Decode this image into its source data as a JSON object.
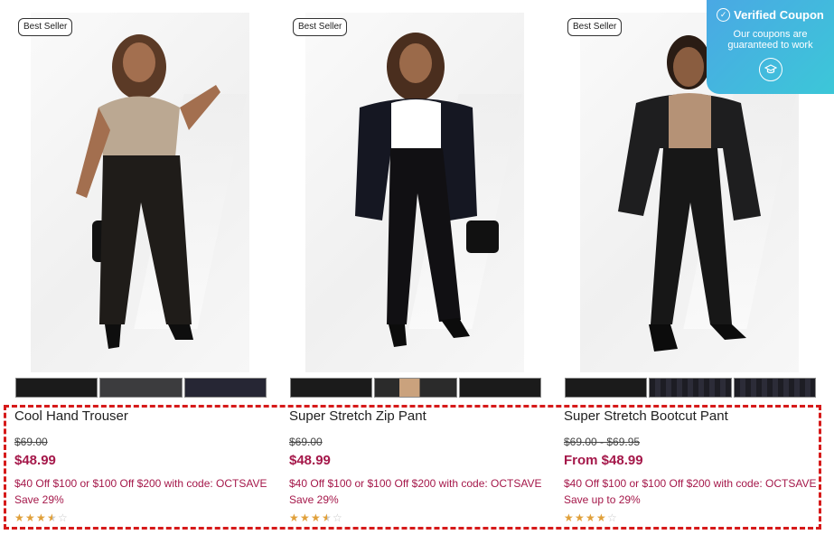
{
  "products": [
    {
      "badge": "Best Seller",
      "name": "Cool Hand Trouser",
      "old_price": "$69.00",
      "new_price": "$48.99",
      "promo": "$40 Off $100 or $100 Off $200 with code: OCTSAVE",
      "save": "Save 29%",
      "rating": 3.5,
      "swatches": [
        "black",
        "charcoal",
        "navy"
      ]
    },
    {
      "badge": "Best Seller",
      "name": "Super Stretch Zip Pant",
      "old_price": "$69.00",
      "new_price": "$48.99",
      "promo": "$40 Off $100 or $100 Off $200 with code: OCTSAVE",
      "save": "Save 29%",
      "rating": 3.5,
      "swatches": [
        "black",
        "skin",
        "black"
      ]
    },
    {
      "badge": "Best Seller",
      "name": "Super Stretch Bootcut Pant",
      "old_price": "$69.00 - $69.95",
      "new_price": "From $48.99",
      "promo": "$40 Off $100 or $100 Off $200 with code: OCTSAVE",
      "save": "Save up to 29%",
      "rating": 4,
      "swatches": [
        "black",
        "plaid",
        "plaid"
      ]
    }
  ],
  "coupon": {
    "title": "Verified Coupon",
    "subtitle": "Our coupons are guaranteed to work",
    "icon": "graduation-cap-icon"
  },
  "colors": {
    "price_accent": "#a5184a",
    "highlight_border": "#d61a1a",
    "coupon_gradient_start": "#4aa8e4",
    "coupon_gradient_end": "#3cc7d8",
    "star": "#e0a03a"
  }
}
